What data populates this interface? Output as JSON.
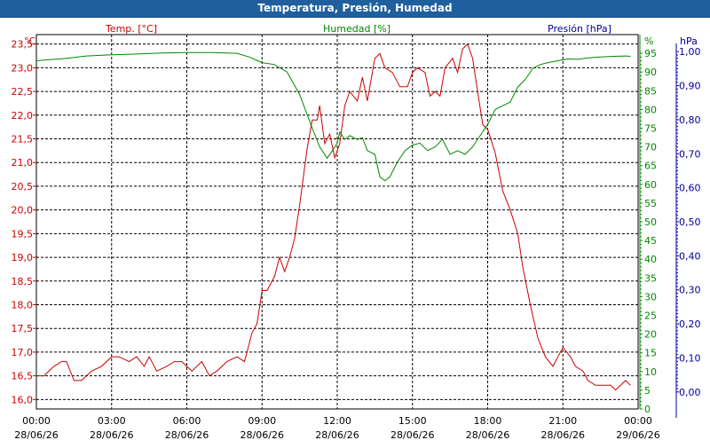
{
  "window": {
    "title": "Temperatura, Presión, Humedad"
  },
  "chart_data": {
    "type": "line",
    "title": "Temperatura, Presión, Humedad",
    "grid": true,
    "axes": {
      "temp": {
        "label": "Temp. [°C]",
        "unit": "°C",
        "range": [
          15.8,
          23.7
        ],
        "ticks": [
          "16,0",
          "16,5",
          "17,0",
          "17,5",
          "18,0",
          "18,5",
          "19,0",
          "19,5",
          "20,0",
          "20,5",
          "21,0",
          "21,5",
          "22,0",
          "22,5",
          "23,0",
          "23,5"
        ],
        "color": "#cc0000"
      },
      "humidity": {
        "label": "Humedad [%]",
        "unit": "%",
        "range": [
          0,
          100
        ],
        "ticks": [
          "0",
          "5",
          "10",
          "15",
          "20",
          "25",
          "30",
          "35",
          "40",
          "45",
          "50",
          "55",
          "60",
          "65",
          "70",
          "75",
          "80",
          "85",
          "90",
          "95"
        ],
        "color": "#008800"
      },
      "pressure": {
        "label": "Presión [hPa]",
        "unit": "hPa",
        "range": [
          -0.05,
          1.05
        ],
        "ticks": [
          "0,00",
          "0,10",
          "0,20",
          "0,30",
          "0,40",
          "0,50",
          "0,60",
          "0,70",
          "0,80",
          "0,90",
          "1,00"
        ],
        "color": "#000099"
      }
    },
    "x_ticks": [
      {
        "time": "00:00",
        "date": "28/06/26"
      },
      {
        "time": "03:00",
        "date": "28/06/26"
      },
      {
        "time": "06:00",
        "date": "28/06/26"
      },
      {
        "time": "09:00",
        "date": "28/06/26"
      },
      {
        "time": "12:00",
        "date": "28/06/26"
      },
      {
        "time": "15:00",
        "date": "28/06/26"
      },
      {
        "time": "18:00",
        "date": "28/06/26"
      },
      {
        "time": "21:00",
        "date": "28/06/26"
      },
      {
        "time": "00:00",
        "date": "29/06/26"
      }
    ],
    "x_range_hours": [
      0,
      24
    ],
    "series": [
      {
        "name": "Temp. [°C]",
        "axis": "temp",
        "color": "#cc0000",
        "points": [
          [
            0,
            16.5
          ],
          [
            0.3,
            16.5
          ],
          [
            0.7,
            16.7
          ],
          [
            1.0,
            16.8
          ],
          [
            1.2,
            16.8
          ],
          [
            1.5,
            16.4
          ],
          [
            1.8,
            16.4
          ],
          [
            2.2,
            16.6
          ],
          [
            2.6,
            16.7
          ],
          [
            3.0,
            16.9
          ],
          [
            3.3,
            16.9
          ],
          [
            3.7,
            16.8
          ],
          [
            4.0,
            16.9
          ],
          [
            4.3,
            16.7
          ],
          [
            4.5,
            16.9
          ],
          [
            4.8,
            16.6
          ],
          [
            5.2,
            16.7
          ],
          [
            5.5,
            16.8
          ],
          [
            5.8,
            16.8
          ],
          [
            6.2,
            16.6
          ],
          [
            6.6,
            16.8
          ],
          [
            6.9,
            16.5
          ],
          [
            7.2,
            16.6
          ],
          [
            7.6,
            16.8
          ],
          [
            8.0,
            16.9
          ],
          [
            8.3,
            16.8
          ],
          [
            8.6,
            17.4
          ],
          [
            8.8,
            17.6
          ],
          [
            9.0,
            18.3
          ],
          [
            9.2,
            18.3
          ],
          [
            9.5,
            18.6
          ],
          [
            9.7,
            19.0
          ],
          [
            9.9,
            18.7
          ],
          [
            10.1,
            19.0
          ],
          [
            10.3,
            19.4
          ],
          [
            10.5,
            20.1
          ],
          [
            10.8,
            21.3
          ],
          [
            11.0,
            21.9
          ],
          [
            11.2,
            21.9
          ],
          [
            11.3,
            22.2
          ],
          [
            11.5,
            21.4
          ],
          [
            11.7,
            21.6
          ],
          [
            11.9,
            21.1
          ],
          [
            12.1,
            21.4
          ],
          [
            12.3,
            22.2
          ],
          [
            12.5,
            22.5
          ],
          [
            12.8,
            22.3
          ],
          [
            13.0,
            22.8
          ],
          [
            13.2,
            22.3
          ],
          [
            13.5,
            23.2
          ],
          [
            13.7,
            23.3
          ],
          [
            13.9,
            23.0
          ],
          [
            14.2,
            22.9
          ],
          [
            14.5,
            22.6
          ],
          [
            14.8,
            22.6
          ],
          [
            15.0,
            22.9
          ],
          [
            15.2,
            23.0
          ],
          [
            15.5,
            22.9
          ],
          [
            15.7,
            22.4
          ],
          [
            15.9,
            22.5
          ],
          [
            16.1,
            22.4
          ],
          [
            16.3,
            23.0
          ],
          [
            16.6,
            23.2
          ],
          [
            16.8,
            22.9
          ],
          [
            17.0,
            23.4
          ],
          [
            17.2,
            23.5
          ],
          [
            17.4,
            23.2
          ],
          [
            17.6,
            22.5
          ],
          [
            17.8,
            21.8
          ],
          [
            18.0,
            21.7
          ],
          [
            18.3,
            21.2
          ],
          [
            18.6,
            20.4
          ],
          [
            18.9,
            20.0
          ],
          [
            19.2,
            19.5
          ],
          [
            19.4,
            18.8
          ],
          [
            19.7,
            18.0
          ],
          [
            20.0,
            17.3
          ],
          [
            20.3,
            16.9
          ],
          [
            20.6,
            16.7
          ],
          [
            20.8,
            16.9
          ],
          [
            21.0,
            17.1
          ],
          [
            21.3,
            16.9
          ],
          [
            21.5,
            16.7
          ],
          [
            21.8,
            16.6
          ],
          [
            22.0,
            16.4
          ],
          [
            22.3,
            16.3
          ],
          [
            22.6,
            16.3
          ],
          [
            22.9,
            16.3
          ],
          [
            23.1,
            16.2
          ],
          [
            23.3,
            16.3
          ],
          [
            23.5,
            16.4
          ],
          [
            23.7,
            16.3
          ]
        ]
      },
      {
        "name": "Humedad [%]",
        "axis": "humidity",
        "color": "#008800",
        "points": [
          [
            0,
            93
          ],
          [
            0.5,
            93.3
          ],
          [
            1.0,
            93.5
          ],
          [
            2.0,
            94.3
          ],
          [
            3.0,
            94.6
          ],
          [
            4.0,
            94.8
          ],
          [
            5.0,
            95.1
          ],
          [
            6.0,
            95.2
          ],
          [
            7.0,
            95.2
          ],
          [
            8.0,
            95.0
          ],
          [
            8.5,
            94
          ],
          [
            9.0,
            92.5
          ],
          [
            9.5,
            92
          ],
          [
            10.0,
            90
          ],
          [
            10.5,
            84
          ],
          [
            11.0,
            75
          ],
          [
            11.3,
            70
          ],
          [
            11.6,
            67
          ],
          [
            11.8,
            69
          ],
          [
            12.0,
            71
          ],
          [
            12.1,
            74
          ],
          [
            12.3,
            72
          ],
          [
            12.5,
            73
          ],
          [
            12.8,
            72
          ],
          [
            13.0,
            72.5
          ],
          [
            13.2,
            69
          ],
          [
            13.5,
            68
          ],
          [
            13.7,
            62
          ],
          [
            13.9,
            61
          ],
          [
            14.1,
            62
          ],
          [
            14.4,
            66
          ],
          [
            14.7,
            69
          ],
          [
            15.0,
            70.5
          ],
          [
            15.3,
            71
          ],
          [
            15.6,
            69
          ],
          [
            15.9,
            70
          ],
          [
            16.2,
            72
          ],
          [
            16.5,
            68
          ],
          [
            16.8,
            69
          ],
          [
            17.1,
            68
          ],
          [
            17.4,
            70
          ],
          [
            17.7,
            73
          ],
          [
            18.0,
            76
          ],
          [
            18.3,
            80
          ],
          [
            18.6,
            81
          ],
          [
            18.9,
            82
          ],
          [
            19.2,
            86
          ],
          [
            19.5,
            88
          ],
          [
            19.8,
            91
          ],
          [
            20.1,
            92
          ],
          [
            20.4,
            92.5
          ],
          [
            20.8,
            93
          ],
          [
            21.2,
            93.5
          ],
          [
            21.6,
            93.4
          ],
          [
            22.0,
            93.8
          ],
          [
            22.5,
            94.0
          ],
          [
            23.0,
            94.2
          ],
          [
            23.5,
            94.3
          ],
          [
            23.7,
            94.2
          ]
        ]
      }
    ]
  }
}
